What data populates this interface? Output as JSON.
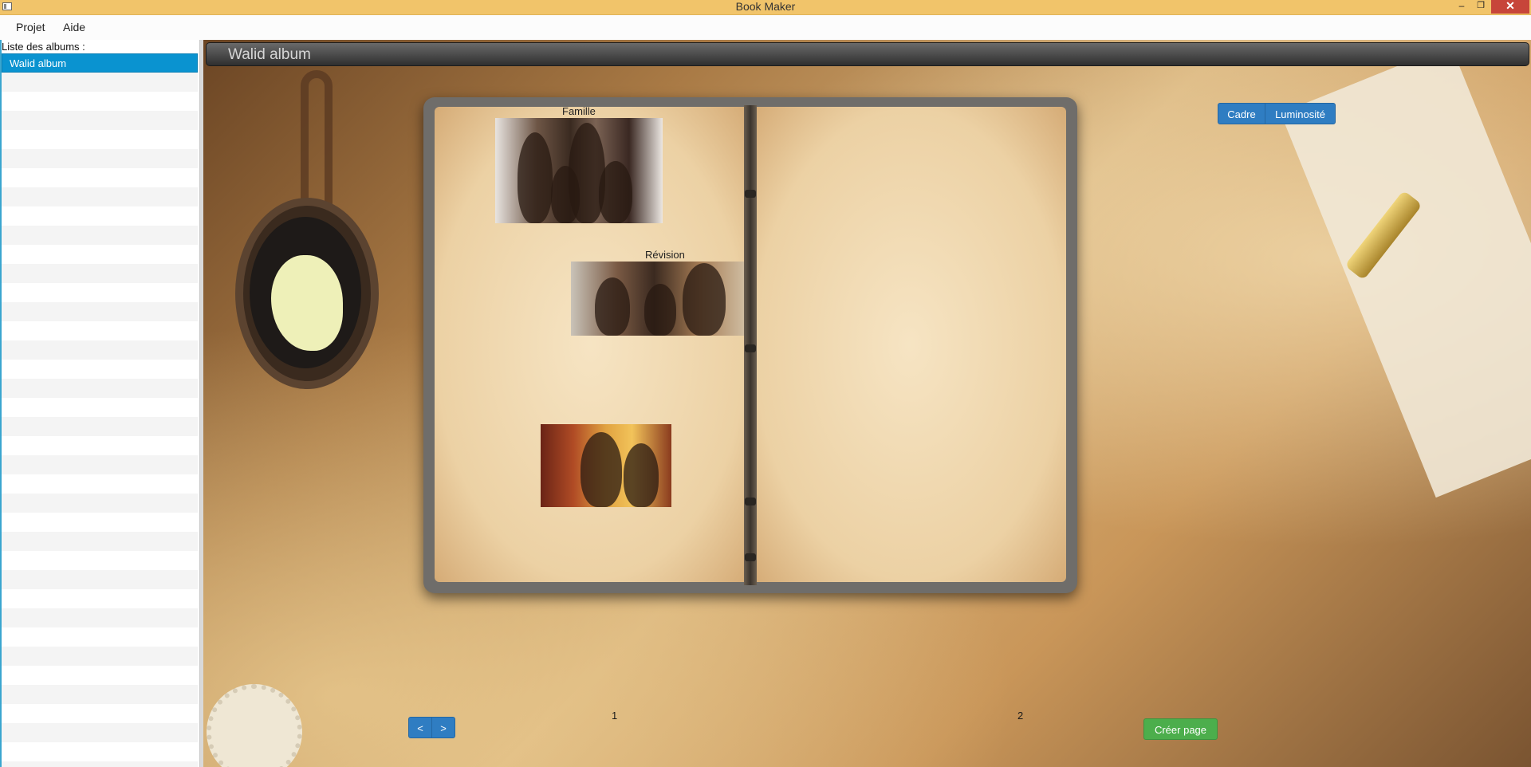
{
  "window": {
    "title": "Book Maker",
    "controls": [
      "–",
      "❐",
      "✕"
    ]
  },
  "menu": {
    "items": [
      "Projet",
      "Aide"
    ]
  },
  "sidebar": {
    "label": "Liste des albums :",
    "albums": [
      {
        "label": "Walid album",
        "selected": true
      }
    ]
  },
  "album": {
    "title": "Walid album"
  },
  "book": {
    "left_page": {
      "number": "1",
      "photos": [
        {
          "caption": "Famille",
          "icon": "family-photo"
        },
        {
          "caption": "Révision",
          "icon": "revision-photo"
        },
        {
          "caption": "",
          "icon": "reading-kids-photo"
        }
      ]
    },
    "right_page": {
      "number": "2"
    }
  },
  "toolbar": {
    "frame_label": "Cadre",
    "brightness_label": "Luminosité"
  },
  "navigation": {
    "prev_label": "<",
    "next_label": ">",
    "create_page_label": "Créer page"
  },
  "colors": {
    "titlebar": "#f1c46a",
    "selection": "#0a93d0",
    "button_blue": "#2f7dc2",
    "button_green": "#4cae4c",
    "close": "#c7453a"
  }
}
